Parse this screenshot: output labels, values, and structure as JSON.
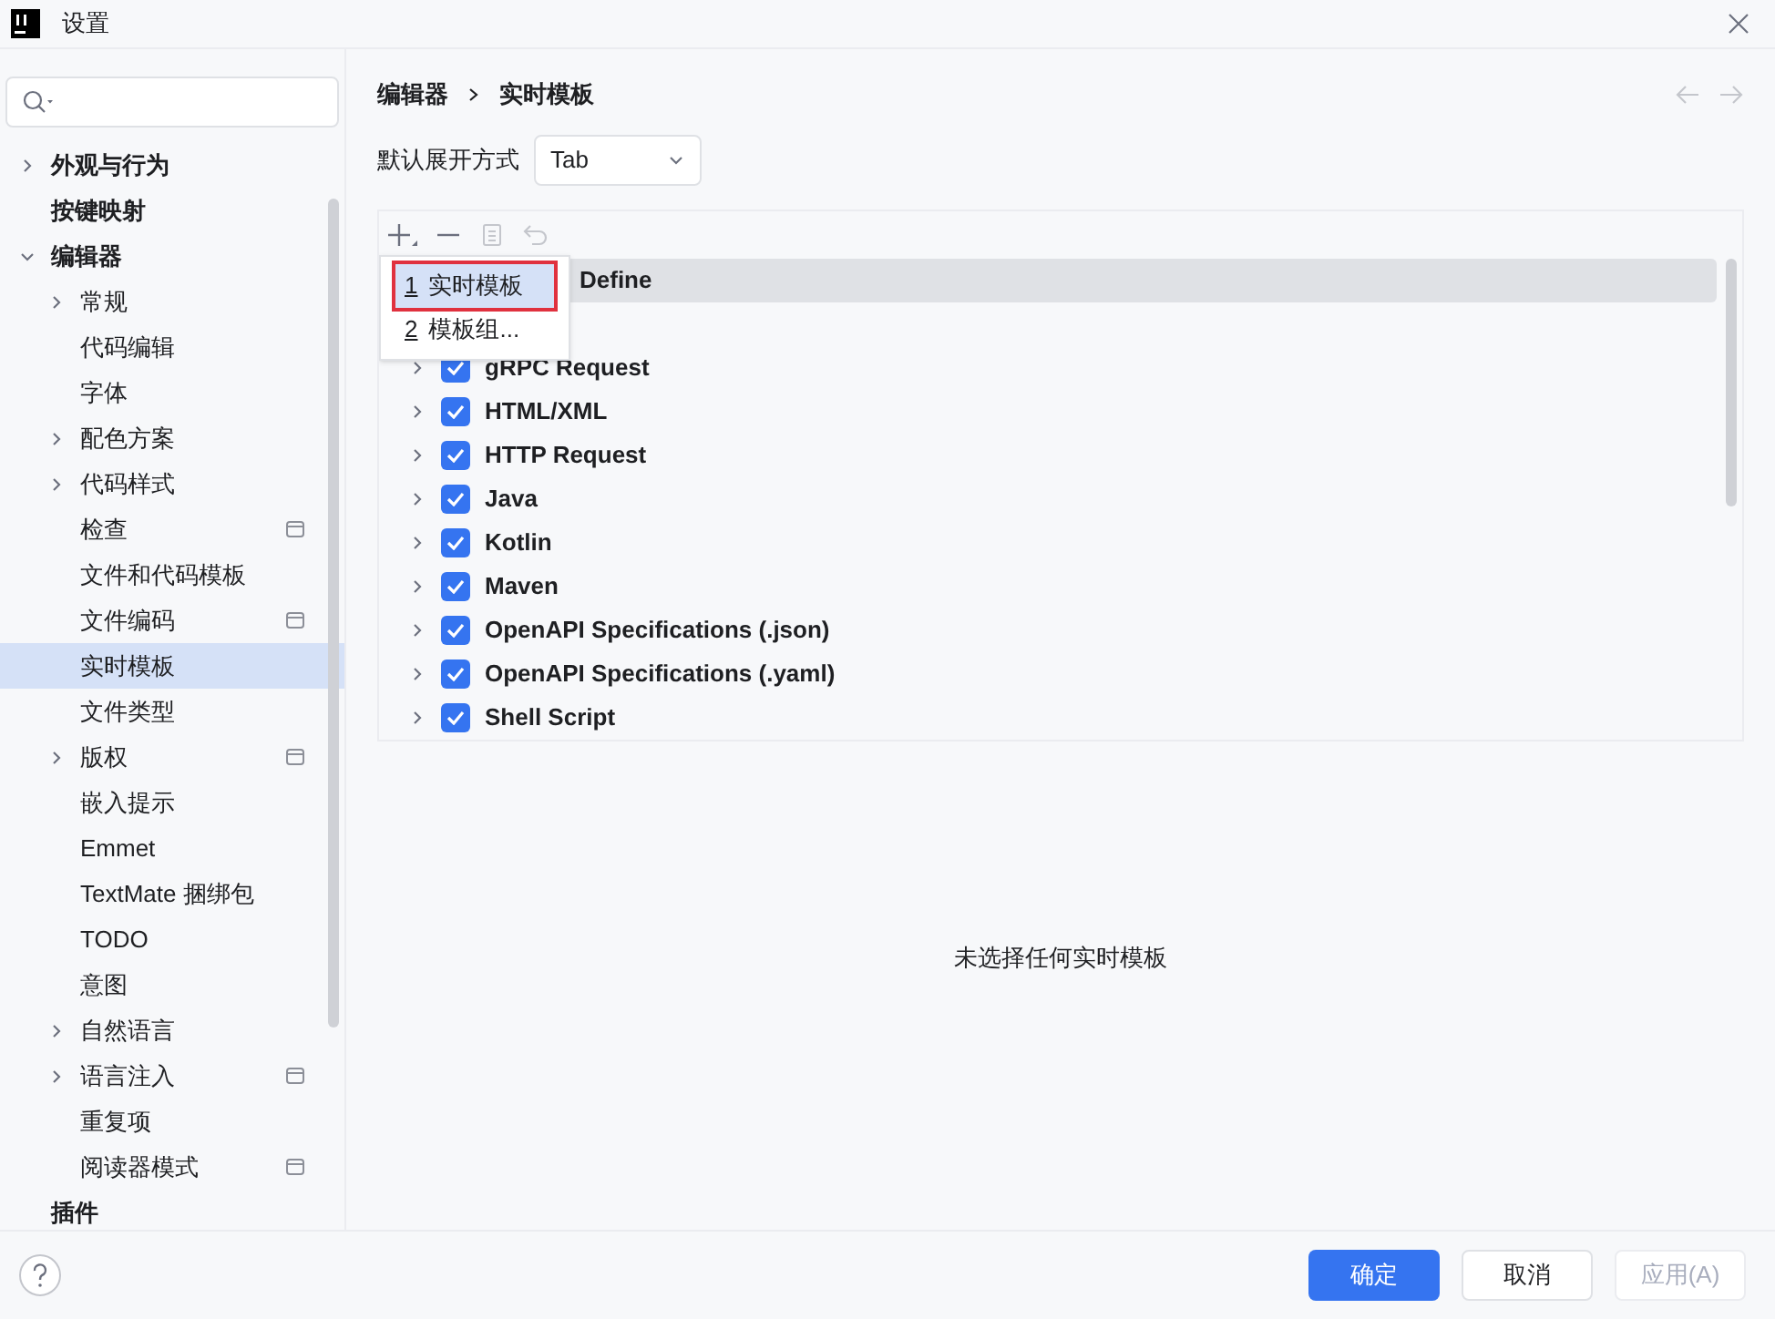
{
  "window": {
    "title": "设置"
  },
  "sidebar": {
    "items": [
      {
        "label": "外观与行为",
        "bold": true,
        "expanded": false,
        "expandable": true,
        "selected": false,
        "badge": false
      },
      {
        "label": "按键映射",
        "bold": true,
        "expandable": false,
        "selected": false,
        "badge": false
      },
      {
        "label": "编辑器",
        "bold": true,
        "expandable": true,
        "expanded": true,
        "selected": false,
        "badge": false,
        "children": [
          {
            "label": "常规",
            "expandable": true,
            "expanded": false,
            "selected": false,
            "badge": false
          },
          {
            "label": "代码编辑",
            "expandable": false,
            "selected": false,
            "badge": false
          },
          {
            "label": "字体",
            "expandable": false,
            "selected": false,
            "badge": false
          },
          {
            "label": "配色方案",
            "expandable": true,
            "expanded": false,
            "selected": false,
            "badge": false
          },
          {
            "label": "代码样式",
            "expandable": true,
            "expanded": false,
            "selected": false,
            "badge": false
          },
          {
            "label": "检查",
            "expandable": false,
            "selected": false,
            "badge": true
          },
          {
            "label": "文件和代码模板",
            "expandable": false,
            "selected": false,
            "badge": false
          },
          {
            "label": "文件编码",
            "expandable": false,
            "selected": false,
            "badge": true
          },
          {
            "label": "实时模板",
            "expandable": false,
            "selected": true,
            "badge": false
          },
          {
            "label": "文件类型",
            "expandable": false,
            "selected": false,
            "badge": false
          },
          {
            "label": "版权",
            "expandable": true,
            "expanded": false,
            "selected": false,
            "badge": true
          },
          {
            "label": "嵌入提示",
            "expandable": false,
            "selected": false,
            "badge": false
          },
          {
            "label": "Emmet",
            "expandable": false,
            "selected": false,
            "badge": false
          },
          {
            "label": "TextMate 捆绑包",
            "expandable": false,
            "selected": false,
            "badge": false
          },
          {
            "label": "TODO",
            "expandable": false,
            "selected": false,
            "badge": false
          },
          {
            "label": "意图",
            "expandable": false,
            "selected": false,
            "badge": false
          },
          {
            "label": "自然语言",
            "expandable": true,
            "expanded": false,
            "selected": false,
            "badge": false
          },
          {
            "label": "语言注入",
            "expandable": true,
            "expanded": false,
            "selected": false,
            "badge": true
          },
          {
            "label": "重复项",
            "expandable": false,
            "selected": false,
            "badge": false
          },
          {
            "label": "阅读器模式",
            "expandable": false,
            "selected": false,
            "badge": true
          }
        ]
      },
      {
        "label": "插件",
        "bold": true,
        "expandable": false,
        "selected": false,
        "badge": false
      }
    ]
  },
  "breadcrumb": [
    "编辑器",
    "实时模板"
  ],
  "expand_with": {
    "label": "默认展开方式",
    "value": "Tab"
  },
  "add_menu": {
    "items": [
      {
        "mnemonic": "1",
        "label": "实时模板",
        "selected": true
      },
      {
        "mnemonic": "2",
        "label": "模板组...",
        "selected": false
      }
    ]
  },
  "template_groups": [
    {
      "name": "Define",
      "selected": true,
      "covered": true
    },
    {
      "name": "gRPC Request",
      "checked": true,
      "selected": false
    },
    {
      "name": "HTML/XML",
      "checked": true,
      "selected": false
    },
    {
      "name": "HTTP Request",
      "checked": true,
      "selected": false
    },
    {
      "name": "Java",
      "checked": true,
      "selected": false
    },
    {
      "name": "Kotlin",
      "checked": true,
      "selected": false
    },
    {
      "name": "Maven",
      "checked": true,
      "selected": false
    },
    {
      "name": "OpenAPI Specifications (.json)",
      "checked": true,
      "selected": false
    },
    {
      "name": "OpenAPI Specifications (.yaml)",
      "checked": true,
      "selected": false
    },
    {
      "name": "Shell Script",
      "checked": true,
      "selected": false
    }
  ],
  "empty_message": "未选择任何实时模板",
  "buttons": [
    {
      "label": "确定",
      "kind": "primary",
      "disabled": false
    },
    {
      "label": "取消",
      "kind": "secondary",
      "disabled": false
    },
    {
      "label": "应用(A)",
      "kind": "secondary",
      "disabled": true
    }
  ]
}
